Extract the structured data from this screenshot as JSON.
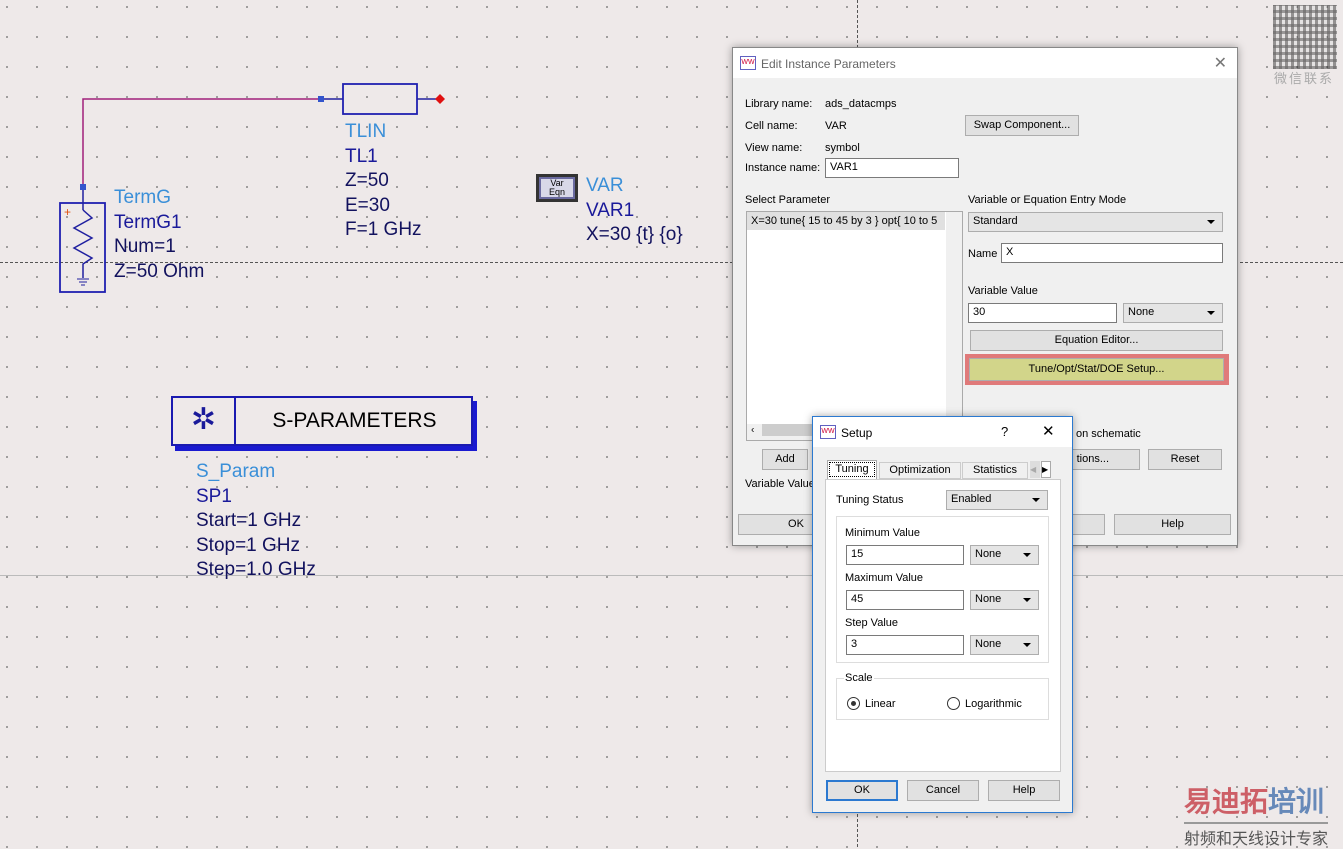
{
  "schematic": {
    "termg": {
      "type": "TermG",
      "name": "TermG1",
      "num": "Num=1",
      "z": "Z=50 Ohm"
    },
    "tlin": {
      "type": "TLIN",
      "name": "TL1",
      "z": "Z=50",
      "e": "E=30",
      "f": "F=1 GHz"
    },
    "var": {
      "icon_line1": "Var",
      "icon_line2": "Eqn",
      "type": "VAR",
      "name": "VAR1",
      "expr": "X=30 {t} {o}"
    },
    "sparam": {
      "title": "S-PARAMETERS",
      "type": "S_Param",
      "name": "SP1",
      "start": "Start=1 GHz",
      "stop": "Stop=1 GHz",
      "step": "Step=1.0 GHz"
    }
  },
  "edit_dialog": {
    "title": "Edit Instance Parameters",
    "library_label": "Library name:",
    "library_value": "ads_datacmps",
    "cell_label": "Cell name:",
    "cell_value": "VAR",
    "view_label": "View name:",
    "view_value": "symbol",
    "instance_label": "Instance name:",
    "instance_value": "VAR1",
    "swap_button": "Swap Component...",
    "select_param_label": "Select Parameter",
    "param_item": "X=30 tune{ 15 to 45 by 3 } opt{ 10 to 5",
    "entry_mode_label": "Variable or Equation Entry Mode",
    "entry_mode_value": "Standard",
    "name_label": "Name",
    "name_value": "X",
    "var_value_label": "Variable Value",
    "var_value": "30",
    "var_unit": "None",
    "equation_editor": "Equation Editor...",
    "tune_setup": "Tune/Opt/Stat/DOE Setup...",
    "display_text": "on schematic",
    "options_button": "tions...",
    "reset_button": "Reset",
    "add_button": "Add",
    "variable_value_bottom": "Variable Value",
    "ok_button": "OK",
    "help_button": "Help",
    "highlight_color": "#e07a7a"
  },
  "setup_dialog": {
    "title": "Setup",
    "help_q": "?",
    "tabs": [
      "Tuning",
      "Optimization",
      "Statistics"
    ],
    "tuning_status_label": "Tuning Status",
    "tuning_status_value": "Enabled",
    "min_label": "Minimum Value",
    "min_value": "15",
    "min_unit": "None",
    "max_label": "Maximum Value",
    "max_value": "45",
    "max_unit": "None",
    "step_label": "Step Value",
    "step_value": "3",
    "step_unit": "None",
    "scale_label": "Scale",
    "linear": "Linear",
    "log": "Logarithmic",
    "ok": "OK",
    "cancel": "Cancel",
    "help": "Help"
  },
  "watermarks": {
    "qr_caption": "微信联系",
    "brand_red": "易迪拓",
    "brand_blue": "培训",
    "tagline": "射频和天线设计专家"
  }
}
